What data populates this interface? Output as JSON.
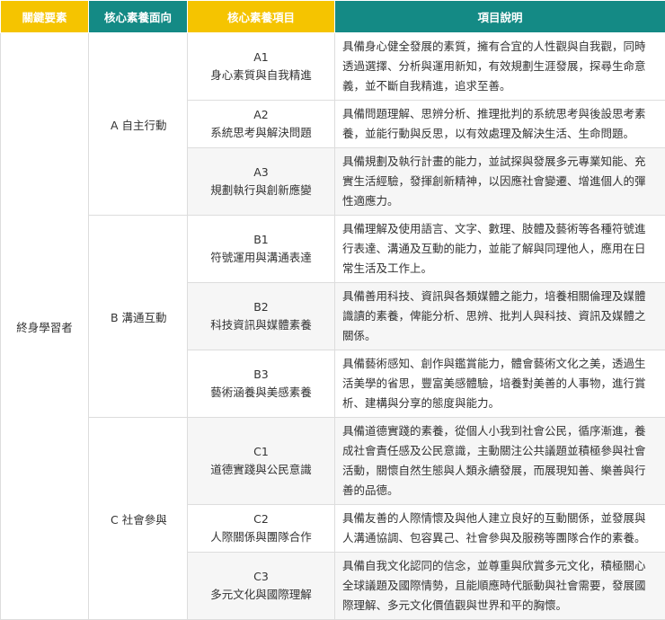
{
  "headers": [
    "關鍵要素",
    "核心素養面向",
    "核心素養項目",
    "項目說明"
  ],
  "key_element": "終身學習者",
  "dimensions": [
    {
      "label": "A 自主行動",
      "items": [
        {
          "code": "A1",
          "name": "身心素質與自我精進",
          "desc": "具備身心健全發展的素質，擁有合宜的人性觀與自我觀，同時透過選擇、分析與運用新知，有效規劃生涯發展，探尋生命意義，並不斷自我精進，追求至善。"
        },
        {
          "code": "A2",
          "name": "系統思考與解決問題",
          "desc": "具備問題理解、思辨分析、推理批判的系統思考與後設思考素養，並能行動與反思，以有效處理及解決生活、生命問題。"
        },
        {
          "code": "A3",
          "name": "規劃執行與創新應變",
          "desc": "具備規劃及執行計畫的能力，並試探與發展多元專業知能、充實生活經驗，發揮創新精神，以因應社會變遷、增進個人的彈性適應力。"
        }
      ]
    },
    {
      "label": "B 溝通互動",
      "items": [
        {
          "code": "B1",
          "name": "符號運用與溝通表達",
          "desc": "具備理解及使用語言、文字、數理、肢體及藝術等各種符號進行表達、溝通及互動的能力，並能了解與同理他人，應用在日常生活及工作上。"
        },
        {
          "code": "B2",
          "name": "科技資訊與媒體素養",
          "desc": "具備善用科技、資訊與各類媒體之能力，培養相關倫理及媒體識讀的素養，俾能分析、思辨、批判人與科技、資訊及媒體之關係。"
        },
        {
          "code": "B3",
          "name": "藝術涵養與美感素養",
          "desc": "具備藝術感知、創作與鑑賞能力，體會藝術文化之美，透過生活美學的省思，豐富美感體驗，培養對美善的人事物，進行賞析、建構與分享的態度與能力。"
        }
      ]
    },
    {
      "label": "C 社會參與",
      "items": [
        {
          "code": "C1",
          "name": "道德實踐與公民意識",
          "desc": "具備道德實踐的素養，從個人小我到社會公民，循序漸進，養成社會責任感及公民意識，主動關注公共議題並積極參與社會活動，關懷自然生態與人類永續發展，而展現知善、樂善與行善的品德。"
        },
        {
          "code": "C2",
          "name": "人際關係與團隊合作",
          "desc": "具備友善的人際情懷及與他人建立良好的互動關係，並發展與人溝通協調、包容異己、社會參與及服務等團隊合作的素養。"
        },
        {
          "code": "C3",
          "name": "多元文化與國際理解",
          "desc": "具備自我文化認同的信念，並尊重與欣賞多元文化，積極關心全球議題及國際情勢，且能順應時代脈動與社會需要，發展國際理解、多元文化價值觀與世界和平的胸懷。"
        }
      ]
    }
  ]
}
